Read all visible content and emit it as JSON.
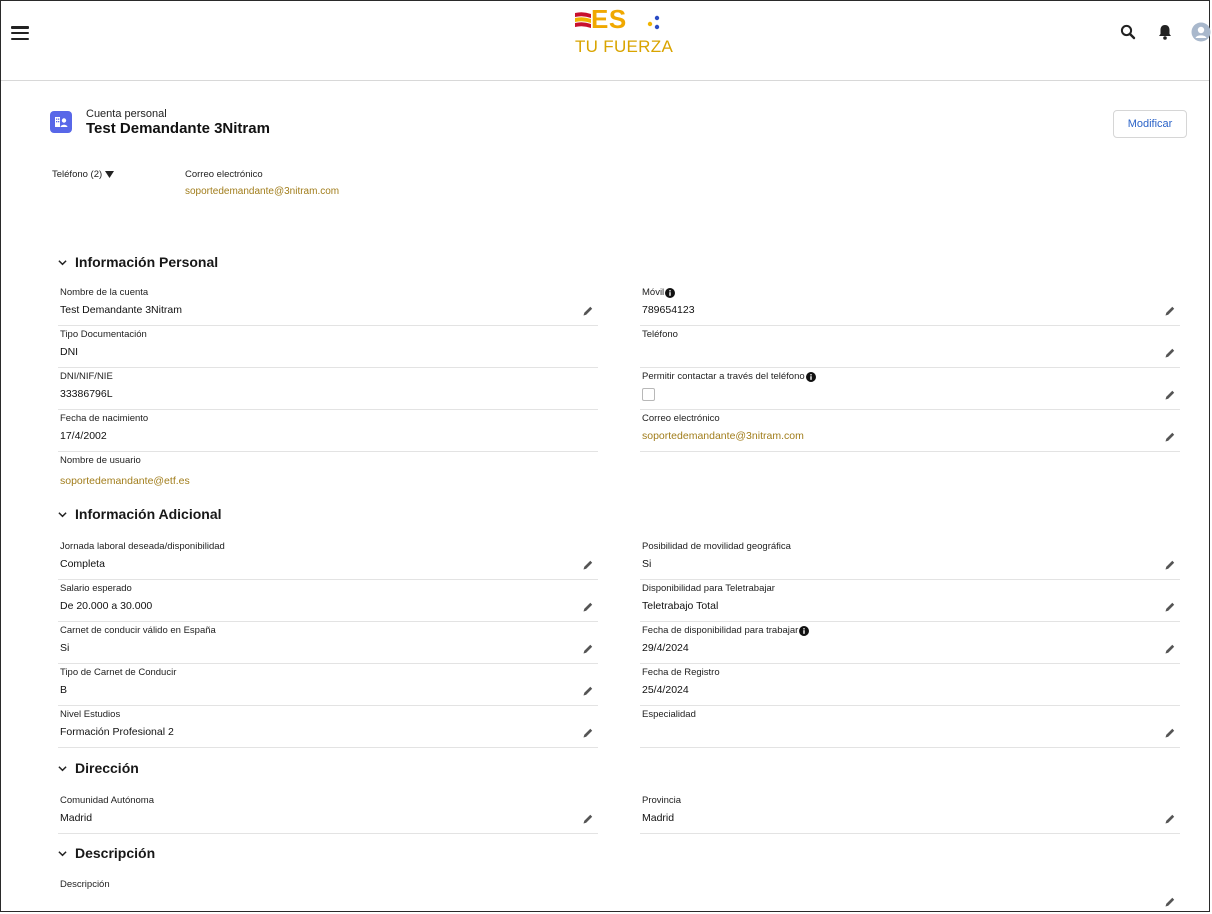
{
  "header": {
    "logo_text": "ES",
    "logo_tagline": "TU FUERZA",
    "colors": {
      "accent_gold": "#d9a400",
      "logo_red": "#c8102e",
      "dot_blue": "#2b4cc4"
    }
  },
  "account": {
    "type_label": "Cuenta personal",
    "name": "Test Demandante 3Nitram",
    "modify_button": "Modificar"
  },
  "highlights": {
    "phone_label": "Teléfono (2)",
    "email_label": "Correo electrónico",
    "email_value": "soportedemandante@3nitram.com"
  },
  "sections": {
    "personal": {
      "title": "Información Personal",
      "left": [
        {
          "label": "Nombre de la cuenta",
          "value": "Test Demandante 3Nitram"
        },
        {
          "label": "Tipo Documentación",
          "value": "DNI"
        },
        {
          "label": "DNI/NIF/NIE",
          "value": "33386796L"
        },
        {
          "label": "Fecha de nacimiento",
          "value": "17/4/2002"
        },
        {
          "label": "Nombre de usuario",
          "value": "soportedemandante@etf.es"
        }
      ],
      "right": [
        {
          "label": "Móvil",
          "value": "789654123"
        },
        {
          "label": "Teléfono",
          "value": ""
        },
        {
          "label": "Permitir contactar a través del teléfono",
          "value": ""
        },
        {
          "label": "Correo electrónico",
          "value": "soportedemandante@3nitram.com"
        }
      ]
    },
    "adicional": {
      "title": "Información Adicional",
      "left": [
        {
          "label": "Jornada laboral deseada/disponibilidad",
          "value": "Completa"
        },
        {
          "label": "Salario esperado",
          "value": "De 20.000 a 30.000"
        },
        {
          "label": "Carnet de conducir válido en España",
          "value": "Si"
        },
        {
          "label": "Tipo de Carnet de Conducir",
          "value": "B"
        },
        {
          "label": "Nivel Estudios",
          "value": "Formación Profesional 2"
        }
      ],
      "right": [
        {
          "label": "Posibilidad de movilidad geográfica",
          "value": "Si"
        },
        {
          "label": "Disponibilidad para Teletrabajar",
          "value": "Teletrabajo Total"
        },
        {
          "label": "Fecha de disponibilidad para trabajar",
          "value": "29/4/2024"
        },
        {
          "label": "Fecha de Registro",
          "value": "25/4/2024"
        },
        {
          "label": "Especialidad",
          "value": ""
        }
      ]
    },
    "direccion": {
      "title": "Dirección",
      "left": [
        {
          "label": "Comunidad Autónoma",
          "value": "Madrid"
        }
      ],
      "right": [
        {
          "label": "Provincia",
          "value": "Madrid"
        }
      ]
    },
    "descripcion": {
      "title": "Descripción",
      "left": [
        {
          "label": "Descripción",
          "value": ""
        }
      ]
    }
  }
}
